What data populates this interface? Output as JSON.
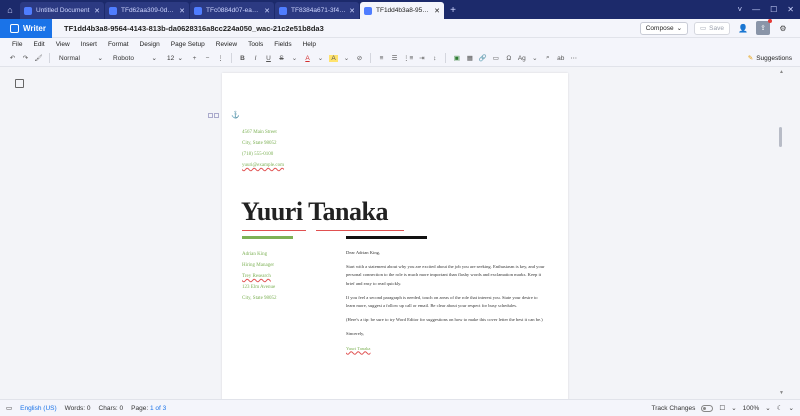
{
  "browser": {
    "tabs": [
      {
        "label": "Untitled Document",
        "active": false
      },
      {
        "label": "TFd62aa309-0d6a-4...",
        "active": false
      },
      {
        "label": "TFc0884d07-ea26-4b...",
        "active": false
      },
      {
        "label": "TF8384a671-3f4b-47...",
        "active": false
      },
      {
        "label": "TF1dd4b3a8-9564-41...",
        "active": true
      }
    ],
    "new_tab": "+",
    "controls": [
      "˅",
      "—",
      "☐",
      "✕"
    ]
  },
  "app": {
    "brand": "Writer",
    "doc_title": "TF1dd4b3a8-9564-4143-813b-da0628316a8cc224a050_wac-21c2e51b8da3",
    "compose_label": "Compose",
    "save_label": "Save"
  },
  "menu": [
    "File",
    "Edit",
    "View",
    "Insert",
    "Format",
    "Design",
    "Page Setup",
    "Review",
    "Tools",
    "Fields",
    "Help"
  ],
  "toolbar": {
    "style": "Normal",
    "font": "Roboto",
    "size": "12",
    "suggestions": "Suggestions"
  },
  "document": {
    "sender_address": [
      "4567 Main Street",
      "City, State 98052",
      "(718) 555-0100",
      "yuuri@example.com"
    ],
    "name": "Yuuri Tanaka",
    "recipient": [
      "Adrian King",
      "Hiring Manager",
      "Trey Research",
      "123 Elm Avenue",
      "City, State 98052"
    ],
    "salutation": "Dear Adrian King,",
    "paragraphs": [
      "Start with a statement about why you are excited about the job you are seeking. Enthusiasm is key, and your personal connection to the role is much more important than flashy words and exclamation marks. Keep it brief and easy to read quickly.",
      "If you feel a second paragraph is needed, touch on areas of the role that interest you. State your desire to learn more, suggest a follow up call or email. Be clear about your respect for busy schedules.",
      "(Here's a tip: be sure to try Word Editor for suggestions on how to make this cover letter the best it can be.)"
    ],
    "closing": "Sincerely,",
    "signature": "Yuuri Tanaka"
  },
  "status": {
    "language": "English (US)",
    "words_label": "Words:",
    "words": "0",
    "chars_label": "Chars:",
    "chars": "0",
    "page_label": "Page:",
    "page_current": "1",
    "page_of": "of 3",
    "track_changes": "Track Changes",
    "zoom": "100%"
  },
  "colors": {
    "brand": "#1a73e8",
    "accent_green": "#7db155",
    "tabstrip": "#1c2a6b"
  }
}
